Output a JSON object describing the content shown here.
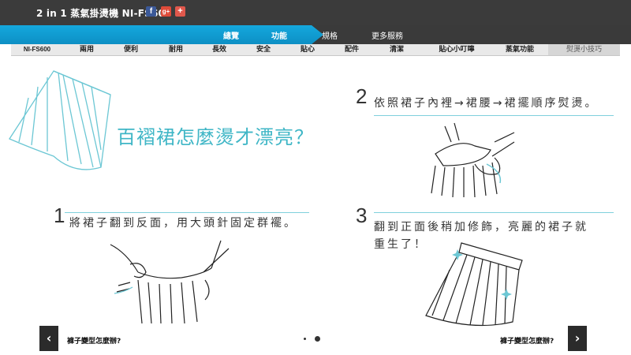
{
  "header": {
    "title": "2 in 1 蒸氣掛燙機 NI-FS600",
    "social": {
      "facebook": "f",
      "googleplus": "g+",
      "plus": "+"
    }
  },
  "nav": {
    "items": [
      "總覽",
      "功能",
      "規格",
      "更多服務"
    ],
    "active": "功能"
  },
  "tabs": {
    "items": [
      "NI-FS600",
      "兩用",
      "便利",
      "耐用",
      "長效",
      "安全",
      "貼心",
      "配件",
      "清潔",
      "貼心小叮嚀",
      "蒸氣功能",
      "熨燙小技巧"
    ],
    "active": "熨燙小技巧"
  },
  "main": {
    "headline": "百褶裙怎麼燙才漂亮？",
    "steps": [
      {
        "num": "1",
        "text": "將裙子翻到反面，用大頭針固定群襬。"
      },
      {
        "num": "2",
        "text": "依照裙子內裡→裙腰→裙擺順序熨燙。"
      },
      {
        "num": "3",
        "text_line1": "翻到正面後稍加修飾，亮麗的裙子就",
        "text_line2": "重生了！"
      }
    ]
  },
  "footer": {
    "prev_label": "褲子變型怎麼辦?",
    "next_label": "褲子變型怎麼辦?",
    "prev_arrow": "‹",
    "next_arrow": "›"
  },
  "colors": {
    "accent": "#14a8dd",
    "teal": "#3fb6c6",
    "topbar": "#3b3b3b"
  }
}
